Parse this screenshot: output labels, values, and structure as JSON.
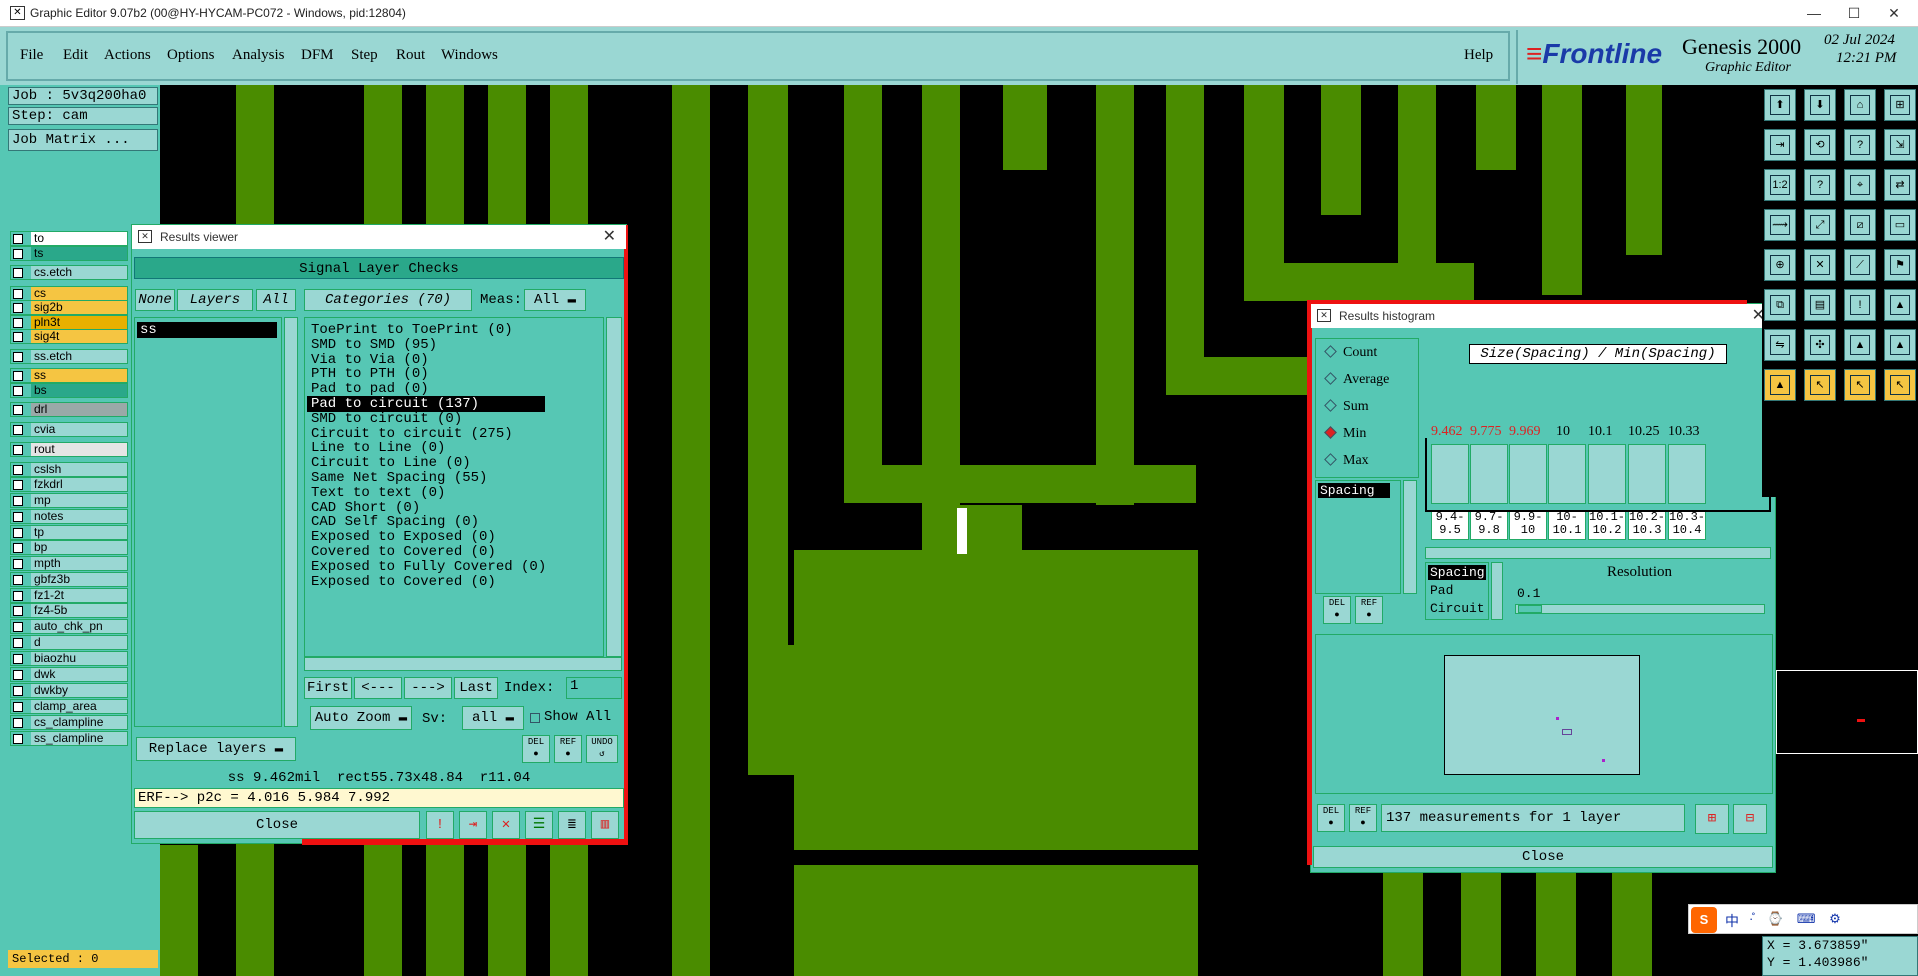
{
  "window": {
    "title": "Graphic Editor 9.07b2 (00@HY-HYCAM-PC072 - Windows, pid:12804)",
    "min": "—",
    "max": "☐",
    "close": "✕"
  },
  "menu": {
    "items": [
      "File",
      "Edit",
      "Actions",
      "Options",
      "Analysis",
      "DFM",
      "Step",
      "Rout",
      "Windows"
    ],
    "help": "Help"
  },
  "brand": {
    "logo": "Frontline",
    "product": "Genesis 2000",
    "subtitle": "Graphic Editor",
    "date": "02 Jul 2024",
    "time": "12:21 PM"
  },
  "job": {
    "job_line": "Job : 5v3q200ha0",
    "step_line": "Step: cam",
    "matrix": "Job Matrix ..."
  },
  "layers": [
    {
      "name": "to",
      "color": "#ffffff"
    },
    {
      "name": "ts",
      "color": "#2aa88a"
    },
    {
      "name": "cs.etch",
      "color": "#9ad7d3"
    },
    {
      "name": "cs",
      "color": "#f5c542"
    },
    {
      "name": "sig2b",
      "color": "#f5c542"
    },
    {
      "name": "pln3t",
      "color": "#e8b000"
    },
    {
      "name": "sig4t",
      "color": "#f5c542"
    },
    {
      "name": "ss.etch",
      "color": "#9ad7d3"
    },
    {
      "name": "ss",
      "color": "#f5c542"
    },
    {
      "name": "bs",
      "color": "#2aa88a"
    },
    {
      "name": "drl",
      "color": "#9aa9a8"
    },
    {
      "name": "cvia",
      "color": "#9ad7d3"
    },
    {
      "name": "rout",
      "color": "#e5e5e5"
    },
    {
      "name": "cslsh",
      "color": "#9ad7d3"
    },
    {
      "name": "fzkdrl",
      "color": "#9ad7d3"
    },
    {
      "name": "mp",
      "color": "#9ad7d3"
    },
    {
      "name": "notes",
      "color": "#9ad7d3"
    },
    {
      "name": "tp",
      "color": "#9ad7d3"
    },
    {
      "name": "bp",
      "color": "#9ad7d3"
    },
    {
      "name": "mpth",
      "color": "#9ad7d3"
    },
    {
      "name": "gbfz3b",
      "color": "#9ad7d3"
    },
    {
      "name": "fz1-2t",
      "color": "#9ad7d3"
    },
    {
      "name": "fz4-5b",
      "color": "#9ad7d3"
    },
    {
      "name": "auto_chk_pn",
      "color": "#9ad7d3"
    },
    {
      "name": "d",
      "color": "#9ad7d3"
    },
    {
      "name": "biaozhu",
      "color": "#9ad7d3"
    },
    {
      "name": "dwk",
      "color": "#9ad7d3"
    },
    {
      "name": "dwkby",
      "color": "#9ad7d3"
    },
    {
      "name": "clamp_area",
      "color": "#9ad7d3"
    },
    {
      "name": "cs_clampline",
      "color": "#9ad7d3"
    },
    {
      "name": "ss_clampline",
      "color": "#9ad7d3"
    }
  ],
  "status": {
    "selected": "Selected : 0"
  },
  "results_viewer": {
    "title": "Results viewer",
    "header": "Signal Layer Checks",
    "none": "None",
    "layers": "Layers",
    "all": "All",
    "categories": "Categories (70)",
    "meas_label": "Meas:",
    "meas_value": "All",
    "layer_item": "ss",
    "categories_list": [
      "ToePrint to ToePrint (0)",
      "SMD to SMD (95)",
      "Via to Via (0)",
      "PTH to PTH (0)",
      "Pad to pad (0)",
      "Pad to circuit (137)",
      "SMD to circuit (0)",
      "Circuit to circuit (275)",
      "Line to Line (0)",
      "Circuit to Line (0)",
      "Same Net Spacing (55)",
      "Text to text (0)",
      "CAD Short (0)",
      "CAD Self Spacing (0)",
      "Exposed to Exposed (0)",
      "Covered to Covered (0)",
      "Exposed to Fully Covered (0)",
      "Exposed to Covered (0)"
    ],
    "selected_index": 5,
    "nav": {
      "first": "First",
      "prev": "<---",
      "next": "--->",
      "last": "Last",
      "index_label": "Index:",
      "index_value": "1"
    },
    "auto_zoom": "Auto Zoom",
    "sv_label": "Sv:",
    "sv_value": "all",
    "show_all": "Show All",
    "replace": "Replace layers",
    "del": "DEL",
    "ref": "REF",
    "undo": "UNDO",
    "info_line": "ss 9.462mil  rect55.73x48.84  r11.04",
    "erf_line": "ERF--> p2c = 4.016 5.984 7.992",
    "close": "Close"
  },
  "histogram": {
    "title": "Results histogram",
    "options": [
      "Count",
      "Average",
      "Sum",
      "Min",
      "Max"
    ],
    "selected_option": "Min",
    "chart_title": "Size(Spacing) / Min(Spacing)",
    "measure": "Spacing",
    "values": [
      "9.462",
      "9.775",
      "9.969",
      "10",
      "10.1",
      "10.25",
      "10.33"
    ],
    "bins": [
      "9.4-\n9.5",
      "9.7-\n9.8",
      "9.9-\n10",
      "10-\n10.1",
      "10.1-\n10.2",
      "10.2-\n10.3",
      "10.3-\n10.4"
    ],
    "group_items": [
      "Spacing",
      "Pad",
      "Circuit"
    ],
    "resolution_label": "Resolution",
    "resolution_value": "0.1",
    "summary": "137 measurements for 1 layer",
    "del": "DEL",
    "ref": "REF",
    "close": "Close"
  },
  "coords": {
    "x": "X = 3.673859\"",
    "y": "Y = 1.403986\""
  },
  "ime": {
    "label": "中"
  }
}
